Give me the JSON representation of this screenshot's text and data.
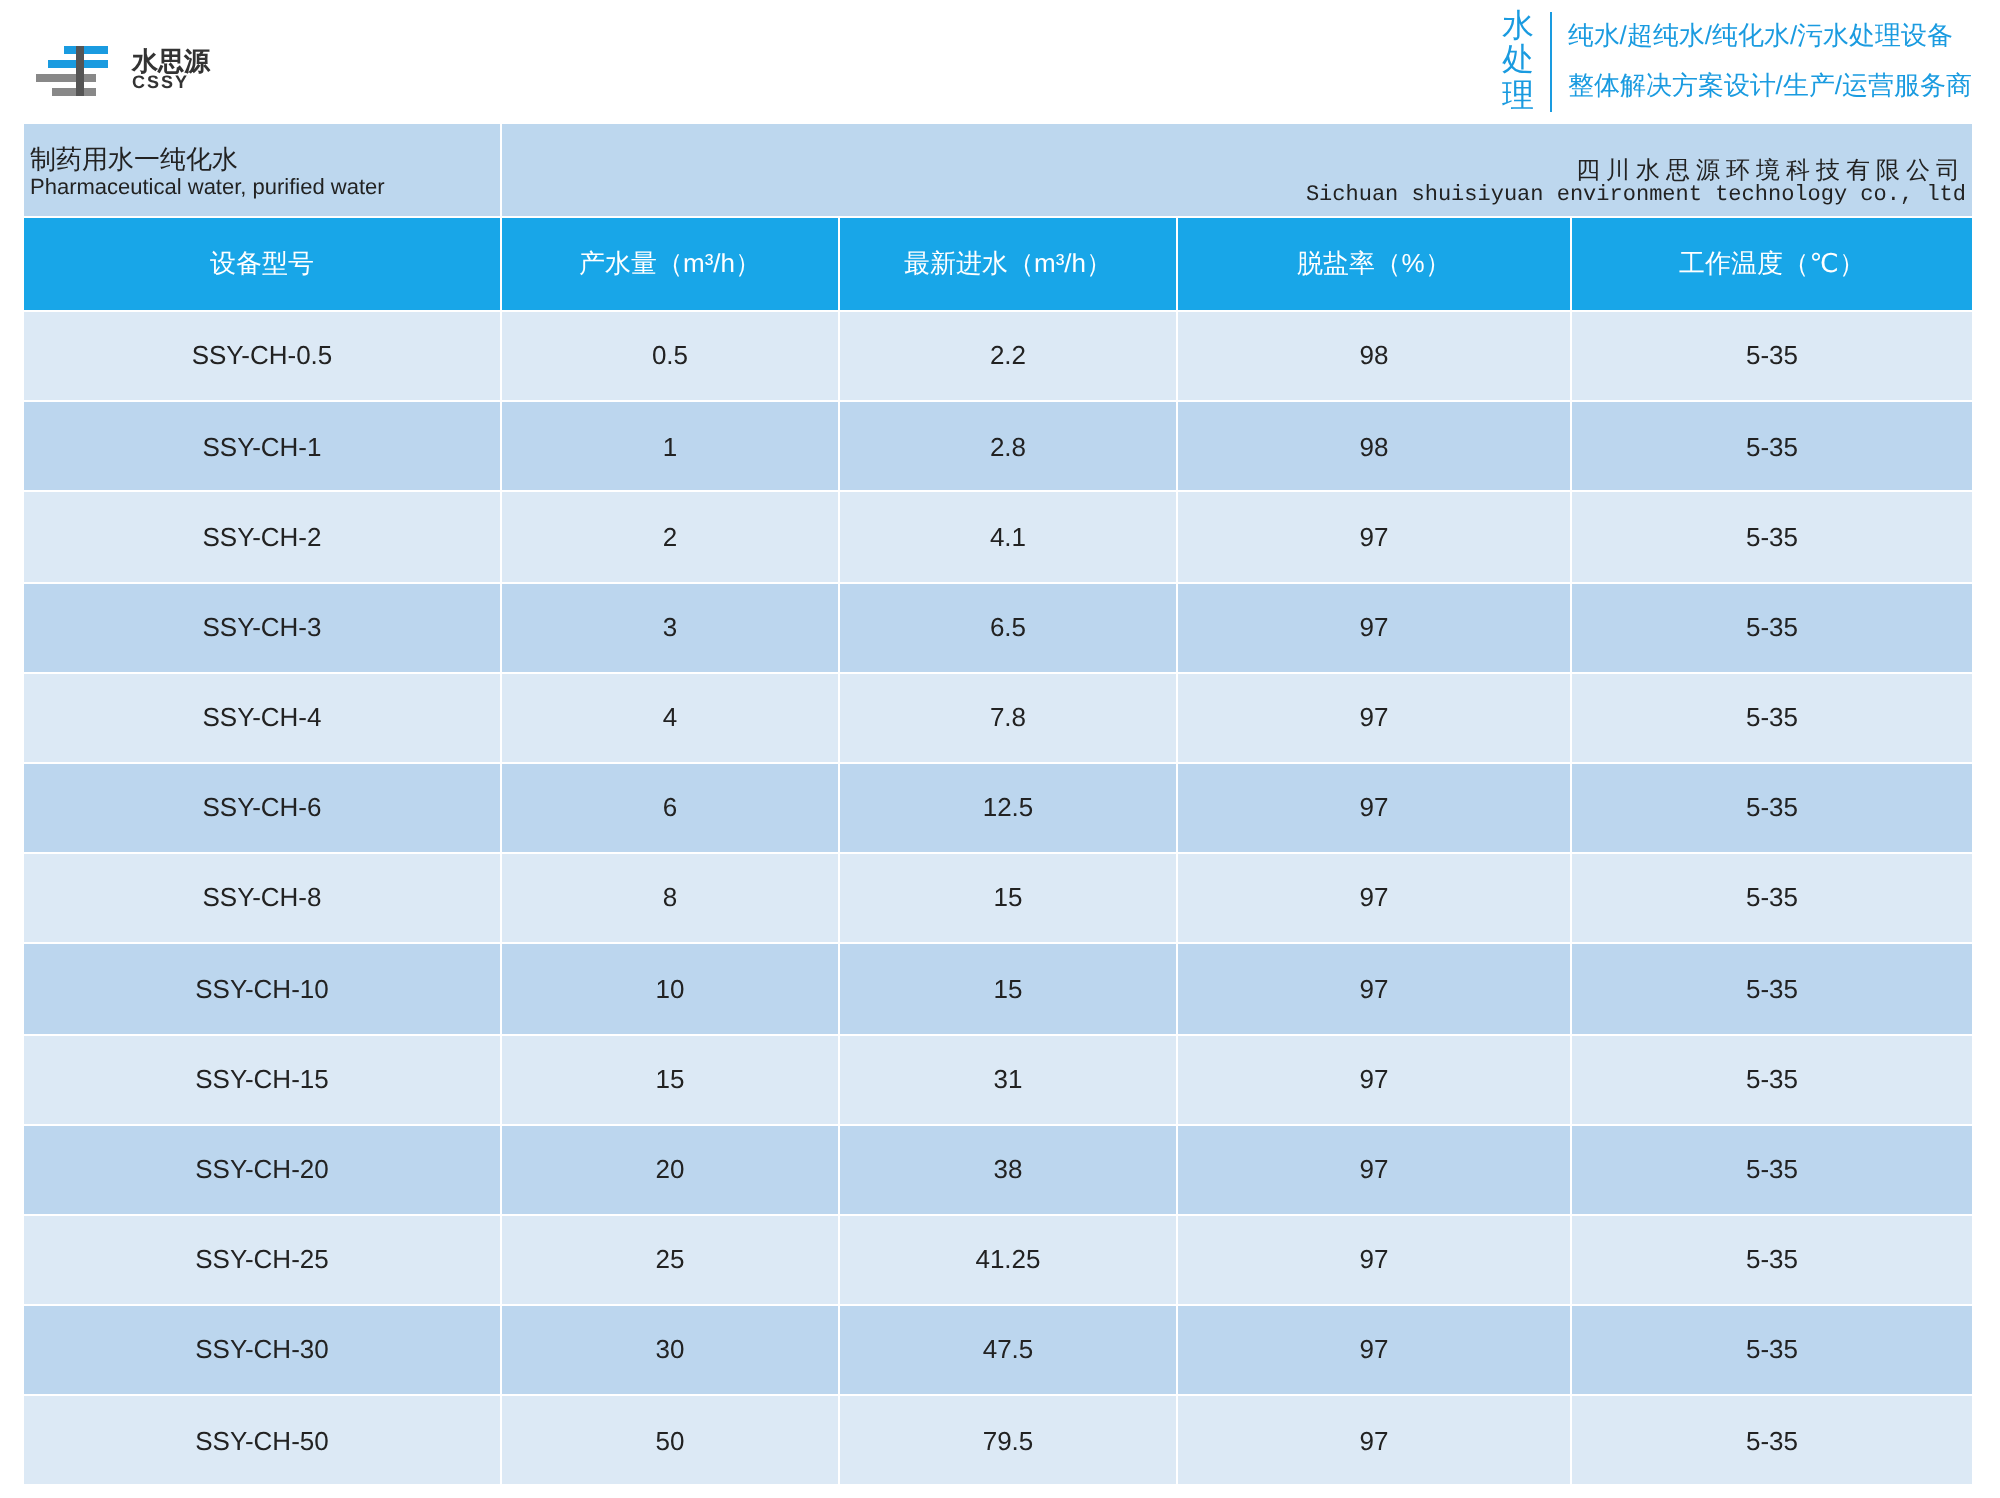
{
  "brand": {
    "name": "水思源",
    "latin": "CSSY"
  },
  "tagline": {
    "vertical": "水处理",
    "lines": [
      "纯水/超纯水/纯化水/污水处理设备",
      "整体解决方案设计/生产/运营服务商"
    ]
  },
  "title_bar": {
    "title": "制药用水一纯化水",
    "subtitle": "Pharmaceutical water, purified water",
    "company": "四川水思源环境科技有限公司",
    "company_en": "Sichuan shuisiyuan environment technology co., ltd"
  },
  "table": {
    "columns": [
      "设备型号",
      "产水量（m³/h）",
      "最新进水（m³/h）",
      "脱盐率（%）",
      "工作温度（℃）"
    ],
    "rows": [
      [
        "SSY-CH-0.5",
        "0.5",
        "2.2",
        "98",
        "5-35"
      ],
      [
        "SSY-CH-1",
        "1",
        "2.8",
        "98",
        "5-35"
      ],
      [
        "SSY-CH-2",
        "2",
        "4.1",
        "97",
        "5-35"
      ],
      [
        "SSY-CH-3",
        "3",
        "6.5",
        "97",
        "5-35"
      ],
      [
        "SSY-CH-4",
        "4",
        "7.8",
        "97",
        "5-35"
      ],
      [
        "SSY-CH-6",
        "6",
        "12.5",
        "97",
        "5-35"
      ],
      [
        "SSY-CH-8",
        "8",
        "15",
        "97",
        "5-35"
      ],
      [
        "SSY-CH-10",
        "10",
        "15",
        "97",
        "5-35"
      ],
      [
        "SSY-CH-15",
        "15",
        "31",
        "97",
        "5-35"
      ],
      [
        "SSY-CH-20",
        "20",
        "38",
        "97",
        "5-35"
      ],
      [
        "SSY-CH-25",
        "25",
        "41.25",
        "97",
        "5-35"
      ],
      [
        "SSY-CH-30",
        "30",
        "47.5",
        "97",
        "5-35"
      ],
      [
        "SSY-CH-50",
        "50",
        "79.5",
        "97",
        "5-35"
      ]
    ]
  }
}
